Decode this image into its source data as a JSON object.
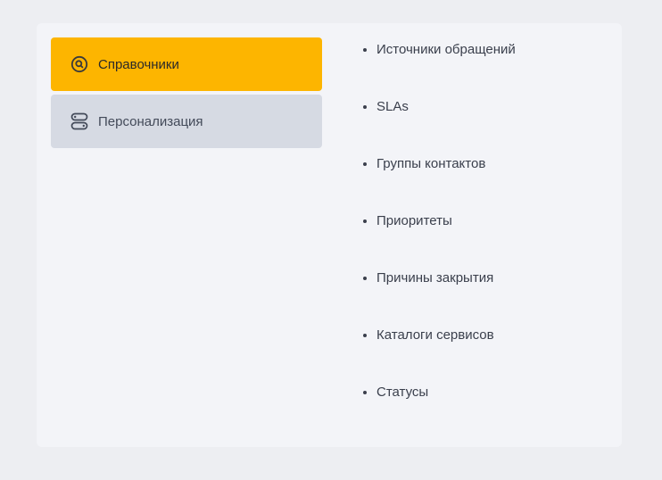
{
  "menu": {
    "items": [
      {
        "label": "Справочники",
        "icon": "search-circle-icon",
        "active": true
      },
      {
        "label": "Персонализация",
        "icon": "toggles-icon",
        "active": false
      }
    ]
  },
  "catalog_list": {
    "items": [
      "Источники обращений",
      "SLAs",
      "Группы контактов",
      "Приоритеты",
      "Причины закрытия",
      "Каталоги сервисов",
      "Статусы"
    ]
  },
  "colors": {
    "page_background": "#edeef2",
    "panel_background": "#f3f4f8",
    "active_accent": "#fdb500",
    "inactive_item": "#d6dae3",
    "text": "#3a3f4c"
  }
}
